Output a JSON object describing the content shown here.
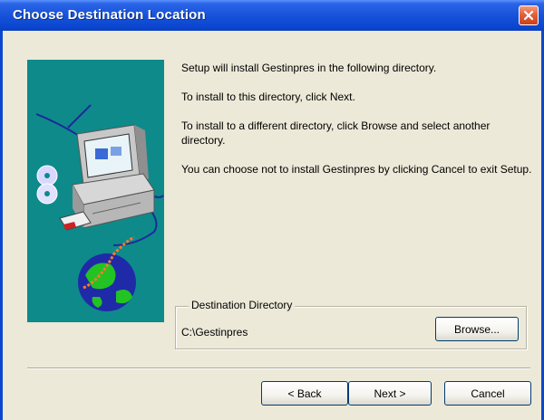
{
  "dialog": {
    "title": "Choose Destination Location",
    "paragraphs": [
      "Setup will install Gestinpres in the following directory.",
      "To install to this directory, click Next.",
      "To install to a different directory, click Browse and select another directory.",
      "You can choose not to install Gestinpres by clicking Cancel to exit Setup."
    ],
    "destination": {
      "legend": "Destination Directory",
      "path": "C:\\Gestinpres",
      "browse_label": "Browse..."
    },
    "buttons": {
      "back_label": "< Back",
      "next_label": "Next >",
      "cancel_label": "Cancel"
    }
  },
  "icons": {
    "close": "close-icon",
    "illustration": "setup-computer-globe-icon"
  },
  "colors": {
    "titlebar": "#0a46cf",
    "illustration_bg": "#0e8a8a",
    "dialog_bg": "#ece9d8"
  }
}
